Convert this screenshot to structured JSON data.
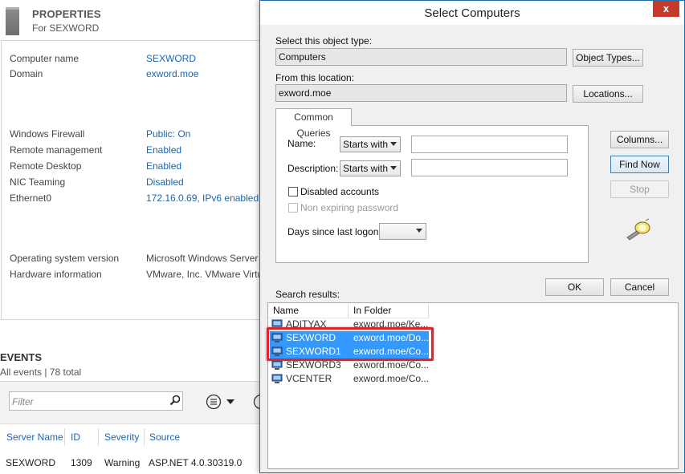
{
  "properties": {
    "title": "PROPERTIES",
    "subtitle": "For SEXWORD",
    "rows1": [
      {
        "label": "Computer name",
        "value": "SEXWORD"
      },
      {
        "label": "Domain",
        "value": "exword.moe"
      }
    ],
    "rows2": [
      {
        "label": "Windows Firewall",
        "value": "Public: On"
      },
      {
        "label": "Remote management",
        "value": "Enabled"
      },
      {
        "label": "Remote Desktop",
        "value": "Enabled"
      },
      {
        "label": "NIC Teaming",
        "value": "Disabled"
      },
      {
        "label": "Ethernet0",
        "value": "172.16.0.69, IPv6 enabled"
      }
    ],
    "rows3": [
      {
        "label": "Operating system version",
        "value": "Microsoft Windows Server"
      },
      {
        "label": "Hardware information",
        "value": "VMware, Inc. VMware Virtu"
      }
    ]
  },
  "events": {
    "title": "EVENTS",
    "subtitle": "All events | 78 total",
    "filter_placeholder": "Filter",
    "columns": [
      "Server Name",
      "ID",
      "Severity",
      "Source"
    ],
    "row": [
      "SEXWORD",
      "1309",
      "Warning",
      "ASP.NET 4.0.30319.0"
    ]
  },
  "dialog": {
    "title": "Select Computers",
    "close": "x",
    "object_type_label": "Select this object type:",
    "object_type_value": "Computers",
    "object_types_button": "Object Types...",
    "location_label": "From this location:",
    "location_value": "exword.moe",
    "locations_button": "Locations...",
    "tab_label": "Common Queries",
    "name_label": "Name:",
    "name_mode": "Starts with",
    "description_label": "Description:",
    "description_mode": "Starts with",
    "disabled_accounts": "Disabled accounts",
    "non_expiring": "Non expiring password",
    "days_label": "Days since last logon:",
    "columns_button": "Columns...",
    "find_now_button": "Find Now",
    "stop_button": "Stop",
    "ok_button": "OK",
    "cancel_button": "Cancel",
    "search_results_label": "Search results:",
    "results_headers": [
      "Name",
      "In Folder"
    ],
    "results": [
      {
        "name": "ADITYAX",
        "folder": "exword.moe/Ke...",
        "selected": false
      },
      {
        "name": "SEXWORD",
        "folder": "exword.moe/Do...",
        "selected": true
      },
      {
        "name": "SEXWORD1",
        "folder": "exword.moe/Co...",
        "selected": true
      },
      {
        "name": "SEXWORD3",
        "folder": "exword.moe/Co...",
        "selected": false
      },
      {
        "name": "VCENTER",
        "folder": "exword.moe/Co...",
        "selected": false
      }
    ]
  },
  "colors": {
    "link": "#1a67b6",
    "selection": "#3399ff",
    "highlight_box": "#e0242b",
    "close_button": "#c7392b"
  }
}
